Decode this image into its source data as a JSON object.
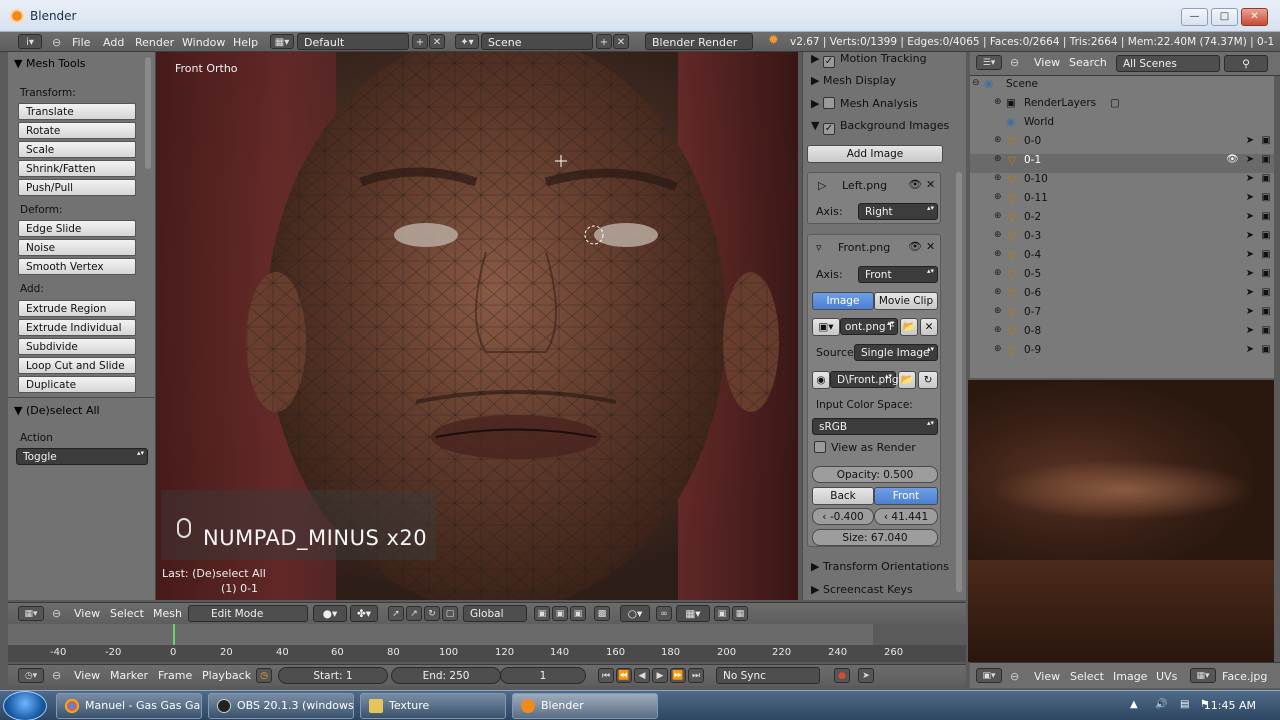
{
  "window": {
    "title": "Blender"
  },
  "topbar": {
    "menus": [
      "File",
      "Add",
      "Render",
      "Window",
      "Help"
    ],
    "layout": "Default",
    "scene": "Scene",
    "engine": "Blender Render",
    "stats": "v2.67 | Verts:0/1399 | Edges:0/4065 | Faces:0/2664 | Tris:2664 | Mem:22.40M (74.37M) | 0-1"
  },
  "toolshelf": {
    "title": "Mesh Tools",
    "transform_label": "Transform:",
    "transform": [
      "Translate",
      "Rotate",
      "Scale",
      "Shrink/Fatten",
      "Push/Pull"
    ],
    "deform_label": "Deform:",
    "deform": [
      "Edge Slide",
      "Noise",
      "Smooth Vertex"
    ],
    "add_label": "Add:",
    "add": [
      "Extrude Region",
      "Extrude Individual",
      "Subdivide",
      "Loop Cut and Slide",
      "Duplicate"
    ],
    "operator_title": "(De)select All",
    "action_label": "Action",
    "action_value": "Toggle"
  },
  "viewport": {
    "view_label": "Front Ortho",
    "screencast_key": "NUMPAD_MINUS x20",
    "last_op": "Last: (De)select All",
    "object_name": "(1) 0-1"
  },
  "props": {
    "motion_tracking": "Motion Tracking",
    "mesh_display": "Mesh Display",
    "mesh_analysis": "Mesh Analysis",
    "background_images": "Background Images",
    "add_image": "Add Image",
    "left_name": "Left.png",
    "axis_label": "Axis:",
    "left_axis": "Right",
    "front_name": "Front.png",
    "front_axis": "Front",
    "image_tab": "Image",
    "movie_clip_tab": "Movie Clip",
    "image_field": "ont.png",
    "image_field_flag": "F",
    "source_label": "Source",
    "source_value": "Single Image",
    "path_value": "D\\Front.png",
    "color_space_label": "Input Color Space:",
    "color_space_value": "sRGB",
    "view_as_render": "View as Render",
    "opacity": "Opacity: 0.500",
    "back": "Back",
    "front": "Front",
    "x_offset": "-0.400",
    "y_offset": "41.441",
    "size": "Size: 67.040",
    "transform_orientations": "Transform Orientations",
    "screencast_keys": "Screencast Keys"
  },
  "outliner": {
    "view": "View",
    "search": "Search",
    "filter": "All Scenes",
    "items": [
      {
        "label": "Scene",
        "indent": 0
      },
      {
        "label": "RenderLayers",
        "indent": 1
      },
      {
        "label": "World",
        "indent": 1
      },
      {
        "label": "0-0",
        "indent": 1
      },
      {
        "label": "0-1",
        "indent": 1
      },
      {
        "label": "0-10",
        "indent": 1
      },
      {
        "label": "0-11",
        "indent": 1
      },
      {
        "label": "0-2",
        "indent": 1
      },
      {
        "label": "0-3",
        "indent": 1
      },
      {
        "label": "0-4",
        "indent": 1
      },
      {
        "label": "0-5",
        "indent": 1
      },
      {
        "label": "0-6",
        "indent": 1
      },
      {
        "label": "0-7",
        "indent": 1
      },
      {
        "label": "0-8",
        "indent": 1
      },
      {
        "label": "0-9",
        "indent": 1
      }
    ]
  },
  "vp_header": {
    "view": "View",
    "select": "Select",
    "mesh": "Mesh",
    "mode": "Edit Mode",
    "orientation": "Global"
  },
  "timeline": {
    "ticks": [
      "-40",
      "-20",
      "0",
      "20",
      "40",
      "60",
      "80",
      "100",
      "120",
      "140",
      "160",
      "180",
      "200",
      "220",
      "240",
      "260"
    ],
    "view": "View",
    "marker": "Marker",
    "frame": "Frame",
    "playback": "Playback",
    "start": "Start: 1",
    "end": "End: 250",
    "current": "1",
    "sync": "No Sync"
  },
  "image_editor": {
    "view": "View",
    "select": "Select",
    "image": "Image",
    "uvs": "UVs",
    "image_name": "Face.jpg"
  },
  "taskbar": {
    "tasks": [
      "Manuel - Gas Gas Ga...",
      "OBS 20.1.3 (windows...",
      "Texture",
      "Blender"
    ],
    "clock": "11:45 AM"
  }
}
